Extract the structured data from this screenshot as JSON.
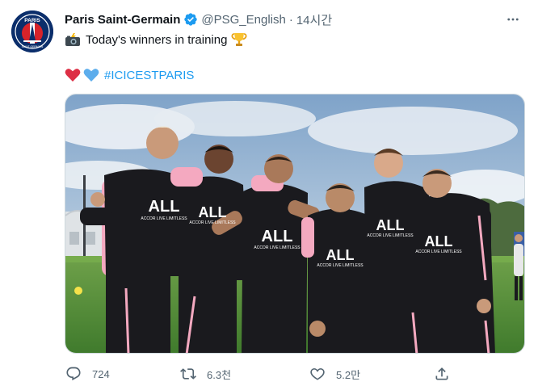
{
  "tweet": {
    "display_name": "Paris Saint-Germain",
    "handle": "@PSG_English",
    "separator": "·",
    "time": "14시간",
    "text_line1": "Today's winners in training",
    "hashtag": "#ICICESTPARIS",
    "avatar_text": "PARIS",
    "avatar_subtext": "SAINT-GERMAIN",
    "photo_shirt_text": "ALL",
    "photo_shirt_subtext": "ACCOR LIVE LIMITLESS",
    "icons": {
      "verified": "verified-badge-icon",
      "more": "more-dots-icon",
      "camera": "camera-flash-emoji-icon",
      "trophy": "trophy-emoji-icon",
      "red_heart": "red-heart-emoji-icon",
      "blue_heart": "blue-heart-emoji-icon"
    },
    "actions": {
      "reply_count": "724",
      "retweet_count": "6.3천",
      "like_count": "5.2만"
    }
  },
  "colors": {
    "accent": "#1d9bf0",
    "text_primary": "#0f1419",
    "text_secondary": "#536471",
    "border": "#cfd9de",
    "psg_navy": "#0b2e6b",
    "psg_red": "#d8232a",
    "kit_pink": "#f4a9c0"
  }
}
